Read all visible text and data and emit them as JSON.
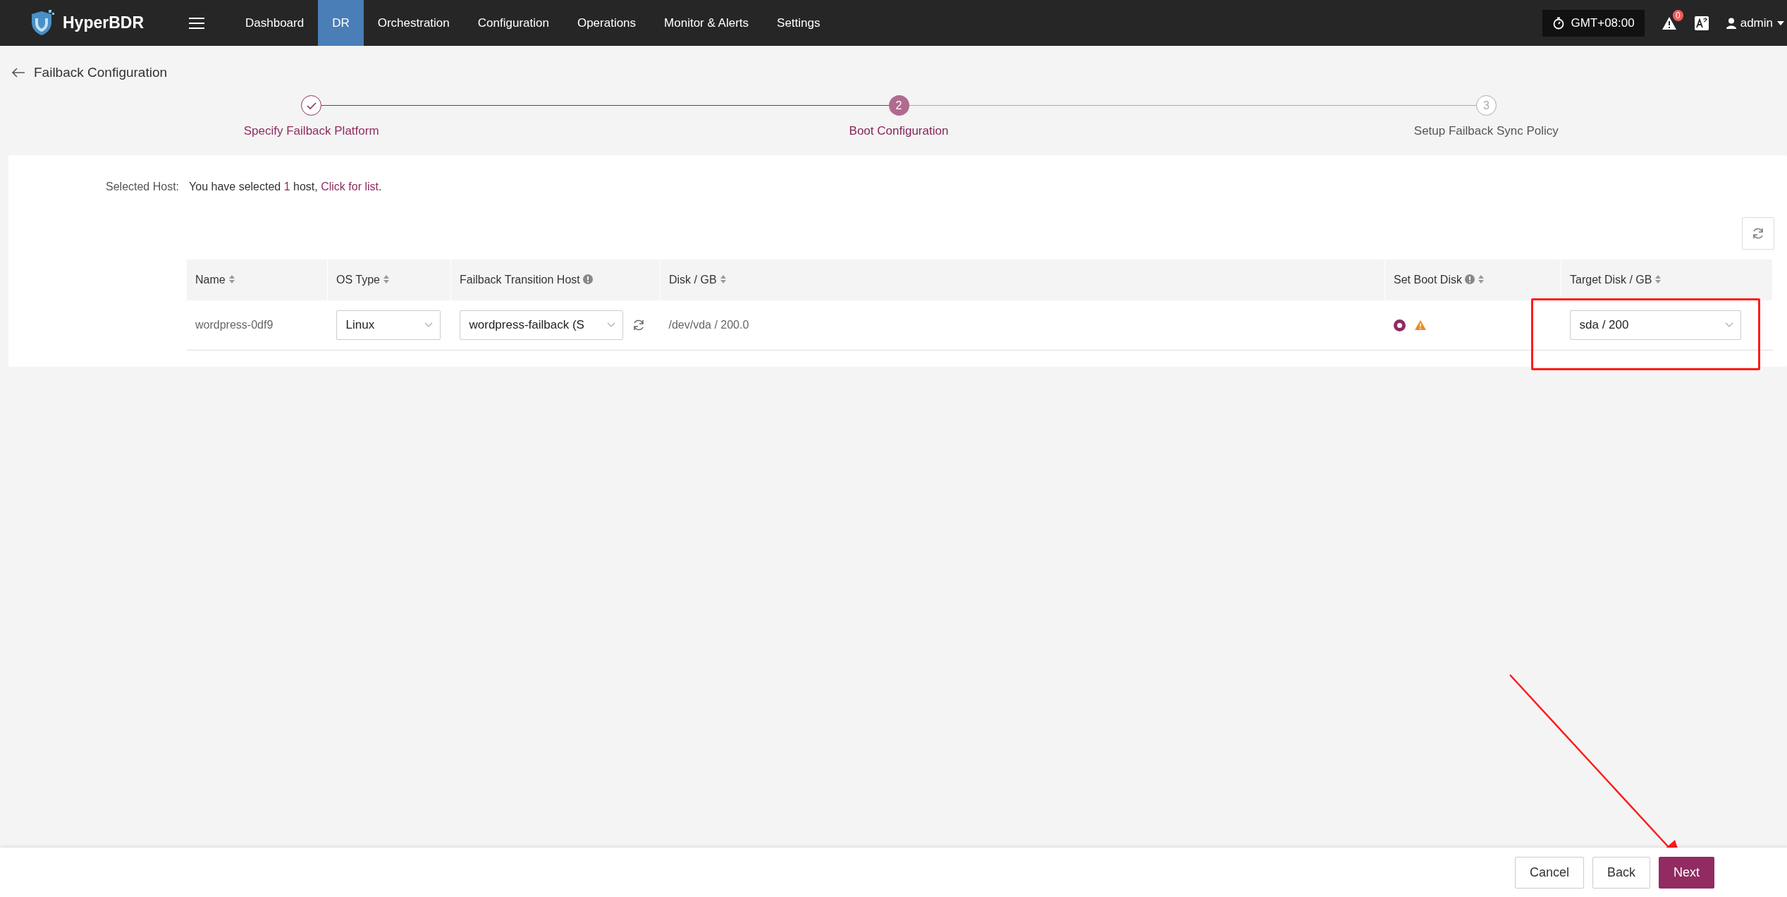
{
  "nav": {
    "brand": "HyperBDR",
    "items": [
      {
        "label": "Dashboard",
        "selected": false
      },
      {
        "label": "DR",
        "selected": true
      },
      {
        "label": "Orchestration",
        "selected": false
      },
      {
        "label": "Configuration",
        "selected": false
      },
      {
        "label": "Operations",
        "selected": false
      },
      {
        "label": "Monitor & Alerts",
        "selected": false
      },
      {
        "label": "Settings",
        "selected": false
      }
    ],
    "timezone": "GMT+08:00",
    "alert_count": "0",
    "user": "admin"
  },
  "page_title": "Failback Configuration",
  "steps": [
    {
      "label": "Specify Failback Platform",
      "completed": true,
      "current": false
    },
    {
      "label": "Boot Configuration",
      "number": "2",
      "completed": false,
      "current": true
    },
    {
      "label": "Setup Failback Sync Policy",
      "number": "3",
      "completed": false,
      "current": false
    }
  ],
  "selection": {
    "label": "Selected Host:",
    "prefix": "You have selected",
    "count": "1",
    "suffix": "host,",
    "link": "Click for list",
    "end": "."
  },
  "table": {
    "columns": [
      {
        "label": "Name",
        "info": false,
        "sortable": true
      },
      {
        "label": "OS Type",
        "info": false,
        "sortable": true
      },
      {
        "label": "Failback Transition Host",
        "info": true,
        "sortable": false
      },
      {
        "label": "Disk / GB",
        "info": false,
        "sortable": true
      },
      {
        "label": "Set Boot Disk",
        "info": true,
        "sortable": true
      },
      {
        "label": "Target Disk / GB",
        "info": false,
        "sortable": true
      }
    ],
    "rows": [
      {
        "name": "wordpress-0df9",
        "os_type": "Linux",
        "transition_host": "wordpress-failback (S",
        "disk": "/dev/vda / 200.0",
        "boot_disk_checked": true,
        "boot_warning": true,
        "target_disk": "sda / 200"
      }
    ]
  },
  "footer": {
    "buttons": [
      {
        "label": "Cancel",
        "kind": "plain"
      },
      {
        "label": "Back",
        "kind": "plain"
      },
      {
        "label": "Next",
        "kind": "primary"
      }
    ]
  }
}
